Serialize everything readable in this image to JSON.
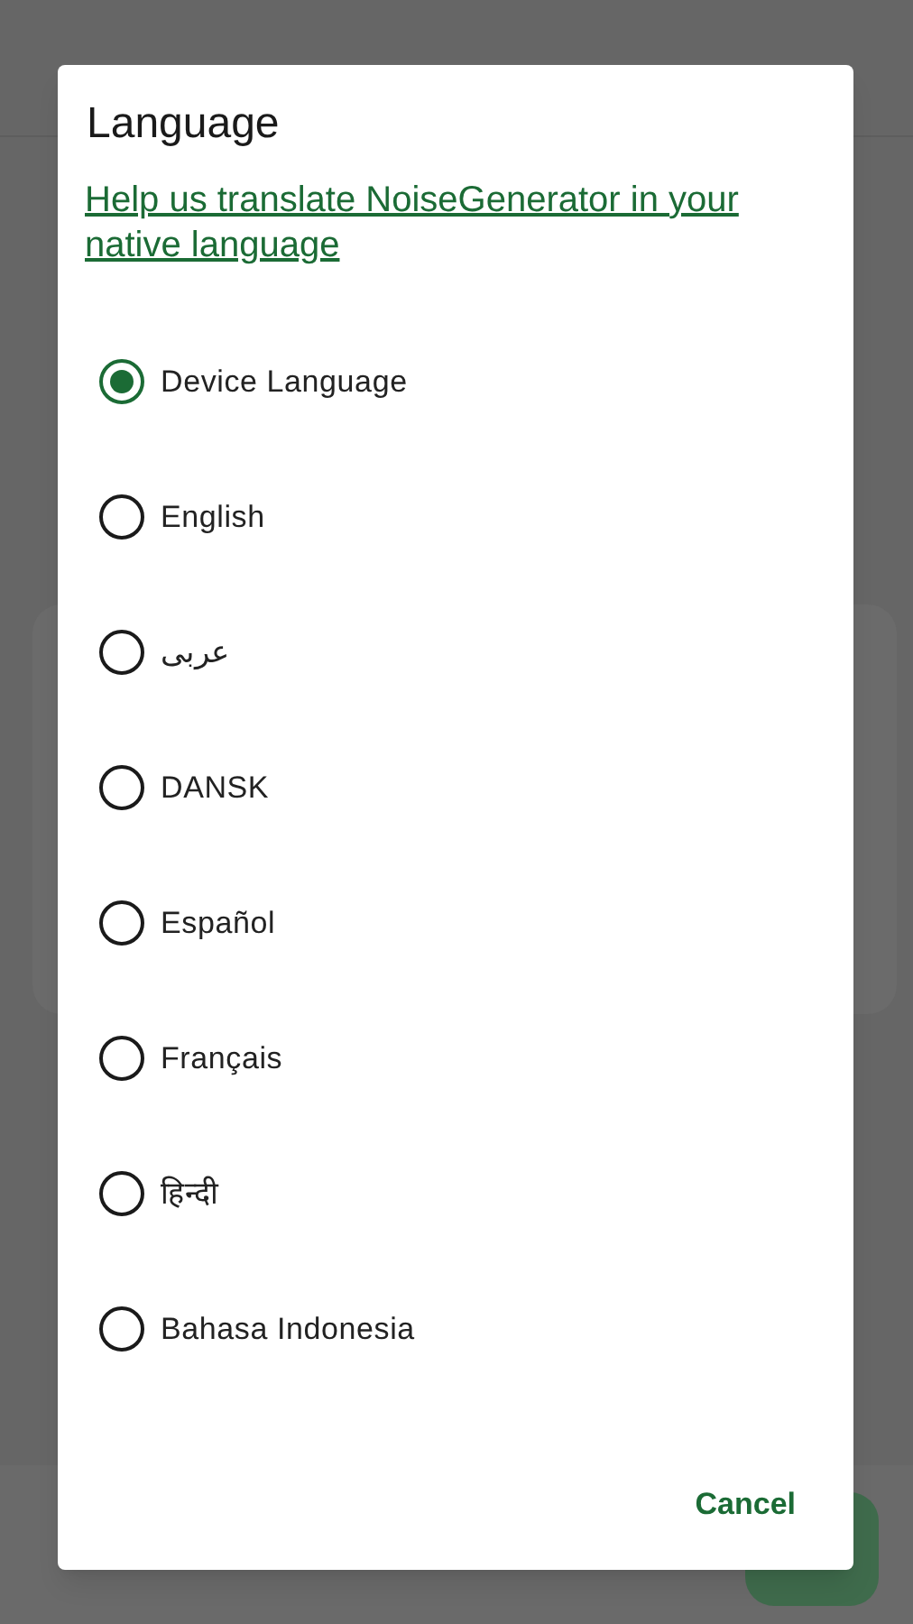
{
  "dialog": {
    "title": "Language",
    "link": "Help us translate NoiseGenerator in your native language",
    "options": [
      {
        "label": "Device Language",
        "selected": true
      },
      {
        "label": "English",
        "selected": false
      },
      {
        "label": "عربى",
        "selected": false
      },
      {
        "label": "DANSK",
        "selected": false
      },
      {
        "label": "Español",
        "selected": false
      },
      {
        "label": "Français",
        "selected": false
      },
      {
        "label": "हिन्दी",
        "selected": false
      },
      {
        "label": "Bahasa Indonesia",
        "selected": false
      }
    ],
    "cancel": "Cancel"
  }
}
